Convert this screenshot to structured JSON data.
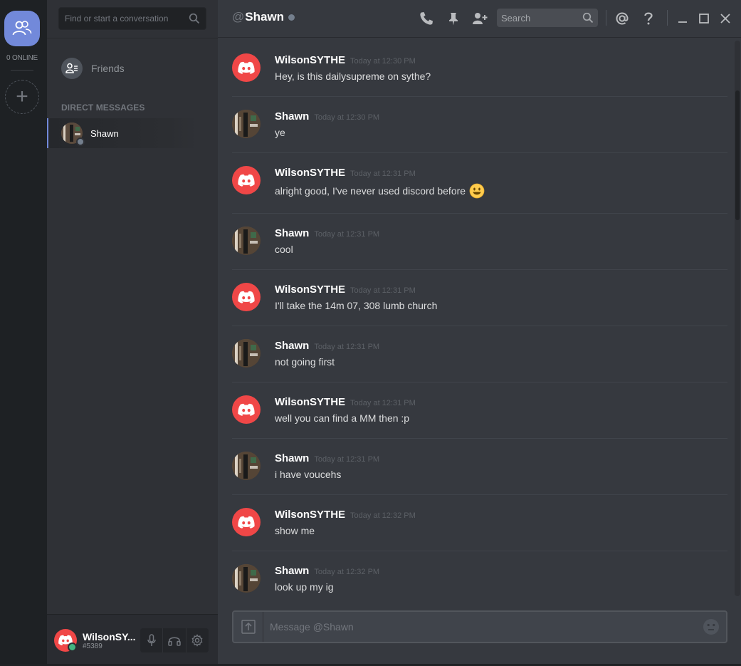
{
  "rail": {
    "online_label": "0 ONLINE"
  },
  "dm_sidebar": {
    "search_placeholder": "Find or start a conversation",
    "friends_label": "Friends",
    "section_header": "DIRECT MESSAGES",
    "items": [
      {
        "label": "Shawn",
        "status": "offline"
      }
    ]
  },
  "user_panel": {
    "name": "WilsonSY...",
    "tag": "#5389",
    "status": "online"
  },
  "header": {
    "at_symbol": "@",
    "channel_name": "Shawn",
    "search_placeholder": "Search",
    "icons": [
      "phone-icon",
      "pin-icon",
      "add-friend-icon",
      "search-icon",
      "mention-icon",
      "help-icon",
      "minimize-icon",
      "maximize-icon",
      "close-icon"
    ]
  },
  "messages": [
    {
      "author": "WilsonSYTHE",
      "timestamp": "Today at 12:30 PM",
      "text": "Hey, is this dailysupreme on sythe?",
      "avatar": "discord"
    },
    {
      "author": "Shawn",
      "timestamp": "Today at 12:30 PM",
      "text": "ye",
      "avatar": "photo"
    },
    {
      "author": "WilsonSYTHE",
      "timestamp": "Today at 12:31 PM",
      "text": "alright good, I've never used discord before",
      "emoji": "smiley",
      "avatar": "discord"
    },
    {
      "author": "Shawn",
      "timestamp": "Today at 12:31 PM",
      "text": "cool",
      "avatar": "photo"
    },
    {
      "author": "WilsonSYTHE",
      "timestamp": "Today at 12:31 PM",
      "text": "I'll take the 14m 07, 308 lumb church",
      "avatar": "discord"
    },
    {
      "author": "Shawn",
      "timestamp": "Today at 12:31 PM",
      "text": "not going first",
      "avatar": "photo"
    },
    {
      "author": "WilsonSYTHE",
      "timestamp": "Today at 12:31 PM",
      "text": "well you can find a MM then :p",
      "avatar": "discord"
    },
    {
      "author": "Shawn",
      "timestamp": "Today at 12:31 PM",
      "text": "i have voucehs",
      "avatar": "photo"
    },
    {
      "author": "WilsonSYTHE",
      "timestamp": "Today at 12:32 PM",
      "text": "show me",
      "avatar": "discord"
    },
    {
      "author": "Shawn",
      "timestamp": "Today at 12:32 PM",
      "text": "look up my ig",
      "avatar": "photo"
    }
  ],
  "composer": {
    "placeholder": "Message @Shawn"
  },
  "colors": {
    "accent": "#7289da",
    "discord_red": "#f04747",
    "online_green": "#43b581",
    "offline_gray": "#747f8d",
    "main_bg": "#36393f",
    "sidebar_bg": "#2f3136",
    "rail_bg": "#1e2124"
  }
}
